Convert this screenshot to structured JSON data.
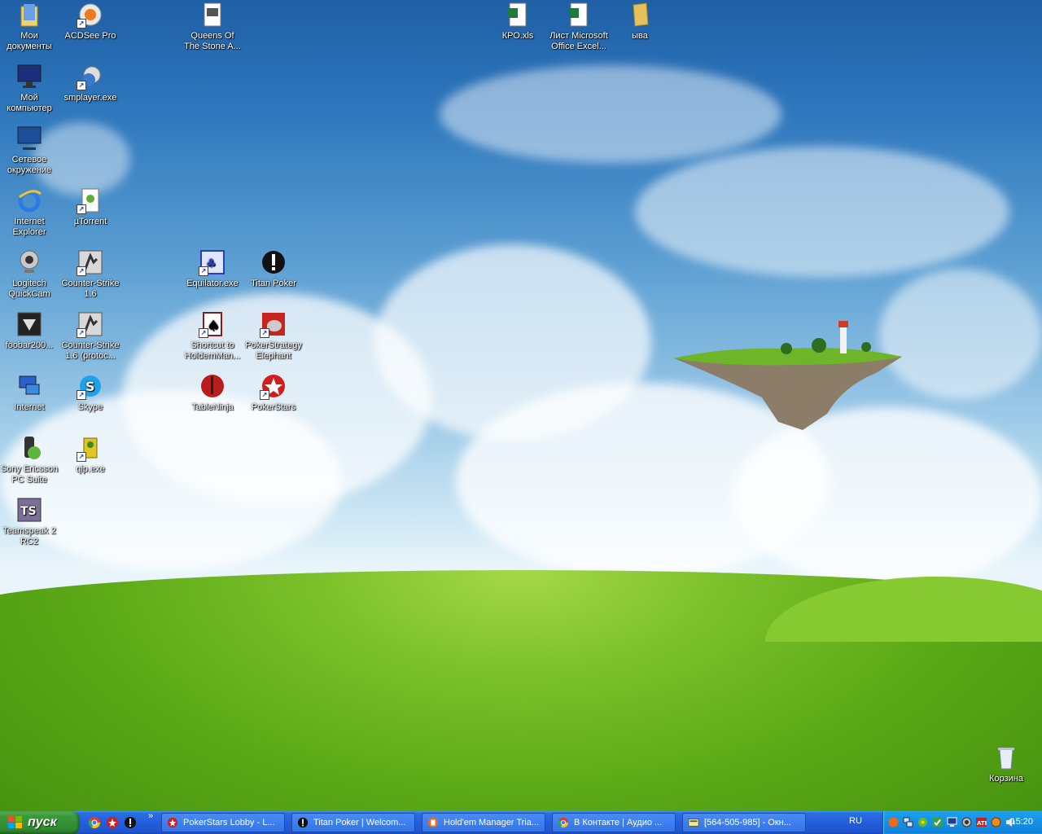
{
  "desktop": {
    "icons": [
      {
        "key": "my_documents",
        "label": "Мои документы"
      },
      {
        "key": "acdsee",
        "label": "ACDSee Pro"
      },
      {
        "key": "queens",
        "label": "Queens Of The Stone A..."
      },
      {
        "key": "kpo",
        "label": "КРО.xls"
      },
      {
        "key": "excel_sheet",
        "label": "Лист Microsoft Office Excel..."
      },
      {
        "key": "folder_yva",
        "label": "ыва"
      },
      {
        "key": "my_computer",
        "label": "Мой компьютер"
      },
      {
        "key": "smplayer",
        "label": "smplayer.exe"
      },
      {
        "key": "network",
        "label": "Сетевое окружение"
      },
      {
        "key": "ie",
        "label": "Internet Explorer"
      },
      {
        "key": "utorrent",
        "label": "µTorrent"
      },
      {
        "key": "quickcam",
        "label": "Logitech QuickCam"
      },
      {
        "key": "cs16",
        "label": "Counter-Strike 1.6"
      },
      {
        "key": "equilator",
        "label": "Equilator.exe"
      },
      {
        "key": "titan",
        "label": "Titan Poker"
      },
      {
        "key": "foobar",
        "label": "foobar200..."
      },
      {
        "key": "cs16_protoc",
        "label": "Counter-Strike 1.6 (protoc..."
      },
      {
        "key": "hm_shortcut",
        "label": "Shortcut to HoldemMan..."
      },
      {
        "key": "ps_elephant",
        "label": "PokerStrategy Elephant"
      },
      {
        "key": "internet",
        "label": "Internet"
      },
      {
        "key": "skype",
        "label": "Skype"
      },
      {
        "key": "tableninja",
        "label": "TableNinja"
      },
      {
        "key": "pokerstars",
        "label": "PokerStars"
      },
      {
        "key": "sonyericsson",
        "label": "Sony Ericsson PC Suite"
      },
      {
        "key": "qip",
        "label": "qip.exe"
      },
      {
        "key": "teamspeak",
        "label": "Teamspeak 2 RC2"
      },
      {
        "key": "recycle",
        "label": "Корзина"
      }
    ]
  },
  "taskbar": {
    "start_label": "пуск",
    "quicklaunch_more": "»",
    "tasks": [
      {
        "label": "PokerStars Lobby - L...",
        "icon": "pokerstars-icon"
      },
      {
        "label": "Titan Poker | Welcom...",
        "icon": "titan-poker-icon"
      },
      {
        "label": "Hold'em Manager Tria...",
        "icon": "holdem-manager-icon"
      },
      {
        "label": "В Контакте | Аудио ...",
        "icon": "chrome-icon"
      },
      {
        "label": "[564-505-985] - Окн...",
        "icon": "qip-window-icon"
      }
    ],
    "language": "RU",
    "clock": "15:20"
  },
  "colors": {
    "taskbar_blue": "#245edb",
    "start_green": "#3c9a3c",
    "tray_blue": "#1590e4"
  }
}
